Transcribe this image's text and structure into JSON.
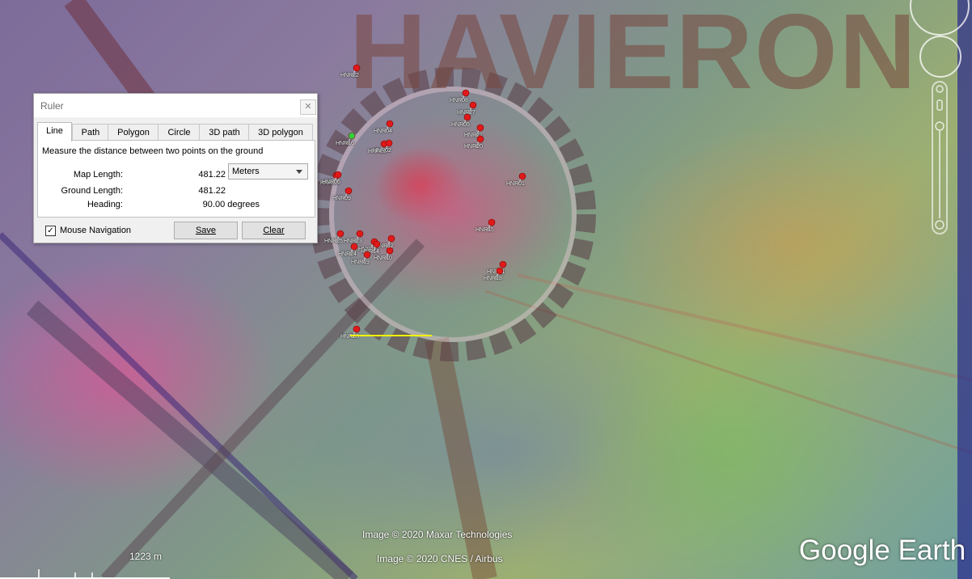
{
  "map": {
    "region_label": "HAVIERON",
    "attribution_1": "Image © 2020 Maxar Technologies",
    "attribution_2": "Image © 2020 CNES / Airbus",
    "logo": "Google Earth",
    "scale_label": "1223 m",
    "pins": [
      {
        "label": "HNR22",
        "color": "red"
      },
      {
        "label": "HNR08",
        "color": "red"
      },
      {
        "label": "HNR27",
        "color": "red"
      },
      {
        "label": "HNR05",
        "color": "red"
      },
      {
        "label": "HNR04",
        "color": "red"
      },
      {
        "label": "HNR21",
        "color": "red"
      },
      {
        "label": "HNR20",
        "color": "red"
      },
      {
        "label": "HNR03",
        "color": "red"
      },
      {
        "label": "HNR16",
        "color": "green"
      },
      {
        "label": "HNR13",
        "color": "red"
      },
      {
        "label": "HNR02",
        "color": "red"
      },
      {
        "label": "HNR01",
        "color": "red"
      },
      {
        "label": "HNR09",
        "color": "red"
      },
      {
        "label": "HNR11",
        "color": "red"
      },
      {
        "label": "HNR23",
        "color": "red"
      },
      {
        "label": "HNR25",
        "color": "red"
      },
      {
        "label": "HNR24",
        "color": "red"
      },
      {
        "label": "HNR17",
        "color": "red"
      },
      {
        "label": "HNR12",
        "color": "red"
      },
      {
        "label": "HNR10",
        "color": "red"
      },
      {
        "label": "HNR14",
        "color": "red"
      },
      {
        "label": "HNR15",
        "color": "red"
      },
      {
        "label": "HNR18",
        "color": "red"
      },
      {
        "label": "HNR06",
        "color": "red"
      },
      {
        "label": "HNR19",
        "color": "red"
      },
      {
        "label": "HNR26",
        "color": "red"
      }
    ]
  },
  "ruler": {
    "title": "Ruler",
    "close_glyph": "✕",
    "tabs": [
      "Line",
      "Path",
      "Polygon",
      "Circle",
      "3D path",
      "3D polygon"
    ],
    "active_tab": "Line",
    "description": "Measure the distance between two points on the ground",
    "map_length_label": "Map Length:",
    "map_length_value": "481.22",
    "unit": "Meters",
    "ground_length_label": "Ground Length:",
    "ground_length_value": "481.22",
    "heading_label": "Heading:",
    "heading_value": "90.00 degrees",
    "mouse_nav_label": "Mouse Navigation",
    "mouse_nav_checked": "✓",
    "save_label": "Save",
    "clear_label": "Clear"
  }
}
